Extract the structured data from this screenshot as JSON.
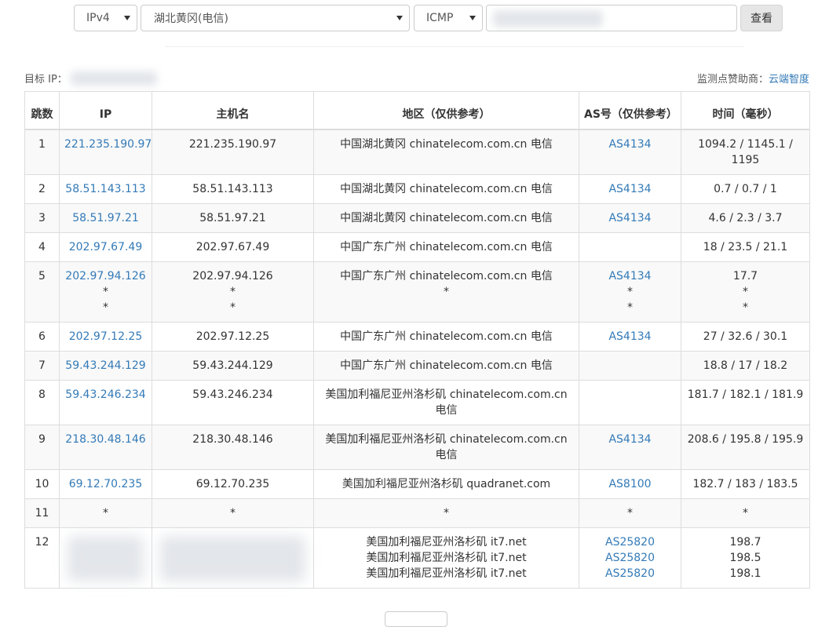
{
  "toolbar": {
    "ip_version": "IPv4",
    "node": "湖北黄冈(电信)",
    "protocol": "ICMP",
    "query_label": "查看"
  },
  "meta": {
    "target_label": "目标 IP：",
    "sponsor_label": "监测点赞助商：",
    "sponsor_name": "云端智度"
  },
  "table": {
    "headers": [
      "跳数",
      "IP",
      "主机名",
      "地区（仅供参考）",
      "AS号（仅供参考）",
      "时间（毫秒）"
    ],
    "rows": [
      {
        "hop": "1",
        "ip": [
          "221.235.190.97"
        ],
        "host": [
          "221.235.190.97"
        ],
        "geo": [
          "中国湖北黄冈 chinatelecom.com.cn 电信"
        ],
        "as": [
          "AS4134"
        ],
        "time": [
          "1094.2 / 1145.1 / 1195"
        ]
      },
      {
        "hop": "2",
        "ip": [
          "58.51.143.113"
        ],
        "host": [
          "58.51.143.113"
        ],
        "geo": [
          "中国湖北黄冈 chinatelecom.com.cn 电信"
        ],
        "as": [
          "AS4134"
        ],
        "time": [
          "0.7 / 0.7 / 1"
        ]
      },
      {
        "hop": "3",
        "ip": [
          "58.51.97.21"
        ],
        "host": [
          "58.51.97.21"
        ],
        "geo": [
          "中国湖北黄冈 chinatelecom.com.cn 电信"
        ],
        "as": [
          "AS4134"
        ],
        "time": [
          "4.6 / 2.3 / 3.7"
        ]
      },
      {
        "hop": "4",
        "ip": [
          "202.97.67.49"
        ],
        "host": [
          "202.97.67.49"
        ],
        "geo": [
          "中国广东广州 chinatelecom.com.cn 电信"
        ],
        "as": [
          ""
        ],
        "time": [
          "18 / 23.5 / 21.1"
        ]
      },
      {
        "hop": "5",
        "ip": [
          "202.97.94.126",
          "*",
          "*"
        ],
        "host": [
          "202.97.94.126",
          "*",
          "*"
        ],
        "geo": [
          "中国广东广州 chinatelecom.com.cn 电信",
          "*"
        ],
        "as": [
          "AS4134",
          "*",
          "*"
        ],
        "time": [
          "17.7",
          "*",
          "*"
        ]
      },
      {
        "hop": "6",
        "ip": [
          "202.97.12.25"
        ],
        "host": [
          "202.97.12.25"
        ],
        "geo": [
          "中国广东广州 chinatelecom.com.cn 电信"
        ],
        "as": [
          "AS4134"
        ],
        "time": [
          "27 / 32.6 / 30.1"
        ]
      },
      {
        "hop": "7",
        "ip": [
          "59.43.244.129"
        ],
        "host": [
          "59.43.244.129"
        ],
        "geo": [
          "中国广东广州 chinatelecom.com.cn 电信"
        ],
        "as": [
          ""
        ],
        "time": [
          "18.8 / 17 / 18.2"
        ]
      },
      {
        "hop": "8",
        "ip": [
          "59.43.246.234"
        ],
        "host": [
          "59.43.246.234"
        ],
        "geo": [
          "美国加利福尼亚州洛杉矶 chinatelecom.com.cn 电信"
        ],
        "as": [
          ""
        ],
        "time": [
          "181.7 / 182.1 / 181.9"
        ]
      },
      {
        "hop": "9",
        "ip": [
          "218.30.48.146"
        ],
        "host": [
          "218.30.48.146"
        ],
        "geo": [
          "美国加利福尼亚州洛杉矶 chinatelecom.com.cn 电信"
        ],
        "as": [
          "AS4134"
        ],
        "time": [
          "208.6 / 195.8 / 195.9"
        ]
      },
      {
        "hop": "10",
        "ip": [
          "69.12.70.235"
        ],
        "host": [
          "69.12.70.235"
        ],
        "geo": [
          "美国加利福尼亚州洛杉矶 quadranet.com"
        ],
        "as": [
          "AS8100"
        ],
        "time": [
          "182.7 / 183 / 183.5"
        ]
      },
      {
        "hop": "11",
        "ip": [
          "*"
        ],
        "host": [
          "*"
        ],
        "geo": [
          "*"
        ],
        "as": [
          "*"
        ],
        "time": [
          "*"
        ]
      },
      {
        "hop": "12",
        "ip": [],
        "host": [],
        "geo": [
          "美国加利福尼亚州洛杉矶 it7.net",
          "美国加利福尼亚州洛杉矶 it7.net",
          "美国加利福尼亚州洛杉矶 it7.net"
        ],
        "as": [
          "AS25820",
          "AS25820",
          "AS25820"
        ],
        "time": [
          "198.7",
          "198.5",
          "198.1"
        ]
      }
    ]
  },
  "colors": {
    "link": "#337ab7",
    "text": "#333333",
    "border": "#dddddd",
    "stripe": "#f9f9f9"
  }
}
